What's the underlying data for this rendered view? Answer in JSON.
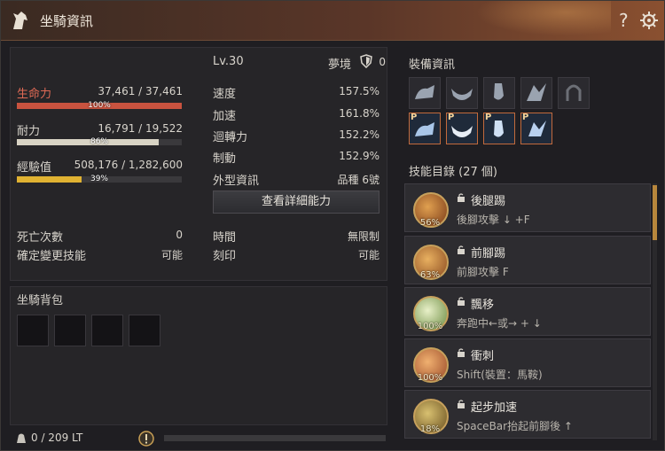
{
  "window": {
    "title": "坐騎資訊",
    "help": "?"
  },
  "stats": {
    "level": "Lv.30",
    "dream_label": "夢境",
    "dream_value": "0",
    "hp_label": "生命力",
    "hp_value": "37,461 / 37,461",
    "hp_pct": "100%",
    "hp_fraction": 1.0,
    "dur_label": "耐力",
    "dur_value": "16,791 / 19,522",
    "dur_pct": "86%",
    "dur_fraction": 0.86,
    "exp_label": "經驗值",
    "exp_value": "508,176 / 1,282,600",
    "exp_pct": "39%",
    "exp_fraction": 0.39,
    "speed_label": "速度",
    "speed_value": "157.5%",
    "accel_label": "加速",
    "accel_value": "161.8%",
    "turn_label": "迴轉力",
    "turn_value": "152.2%",
    "brake_label": "制動",
    "brake_value": "152.9%",
    "appearance_label": "外型資訊",
    "appearance_value": "品種 6號",
    "detail_button": "查看詳細能力",
    "deaths_label": "死亡次數",
    "deaths_value": "0",
    "skill_change_label": "確定變更技能",
    "skill_change_value": "可能",
    "time_label": "時間",
    "time_value": "無限制",
    "engrave_label": "刻印",
    "engrave_value": "可能"
  },
  "bag": {
    "title": "坐騎背包",
    "weight": "0 / 209 LT"
  },
  "equipment": {
    "title": "裝備資訊",
    "premium_label": "P"
  },
  "skills": {
    "title": "技能目錄 (27 個)",
    "items": [
      {
        "name": "後腿踢",
        "cmd": "後腳攻擊 ↓ +F",
        "pct": "56%"
      },
      {
        "name": "前腳踢",
        "cmd": "前腳攻擊 F",
        "pct": "63%"
      },
      {
        "name": "飄移",
        "cmd": "奔跑中←或→ + ↓",
        "pct": "100%"
      },
      {
        "name": "衝刺",
        "cmd": "Shift(裝置：馬鞍)",
        "pct": "100%"
      },
      {
        "name": "起步加速",
        "cmd": "SpaceBar抬起前腳後 ↑",
        "pct": "18%"
      }
    ]
  },
  "colors": {
    "hp": "#c9533f",
    "dur": "#d8d3c4",
    "exp": "#e0b232",
    "accent": "#b8873c"
  }
}
